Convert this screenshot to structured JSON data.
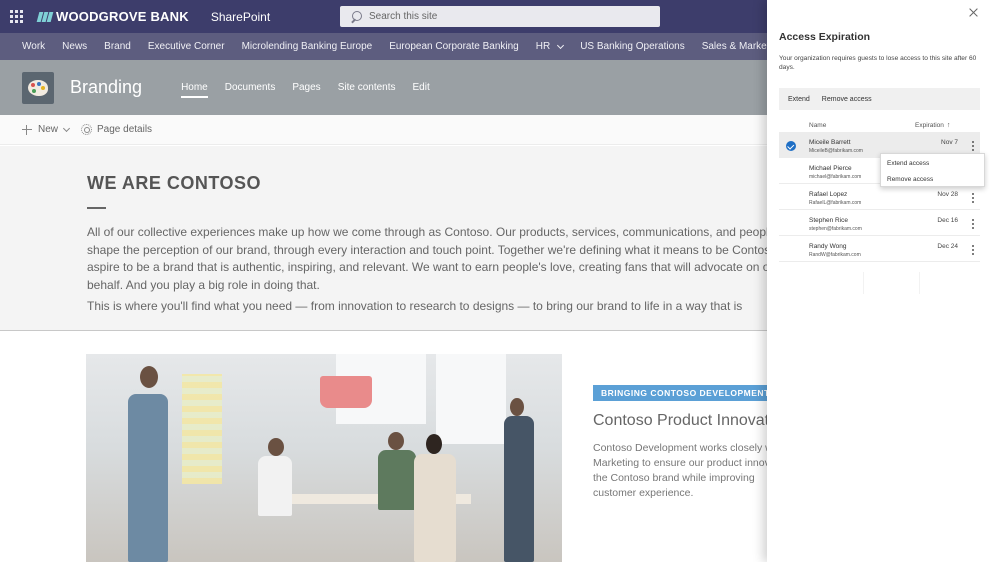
{
  "suite": {
    "brand": "WOODGROVE BANK",
    "app": "SharePoint",
    "search_placeholder": "Search this site"
  },
  "hubnav": [
    "Work",
    "News",
    "Brand",
    "Executive Corner",
    "Microlending Banking Europe",
    "European Corporate Banking",
    "HR",
    "US Banking Operations",
    "Sales & Marketing"
  ],
  "site": {
    "title": "Branding",
    "nav": [
      "Home",
      "Documents",
      "Pages",
      "Site contents",
      "Edit"
    ]
  },
  "commands": {
    "new": "New",
    "page_details": "Page details"
  },
  "hero": {
    "heading": "WE ARE CONTOSO",
    "para1": "All of our collective experiences make up how we come through as Contoso. Our products, services, communications, and people shape the perception of our brand, through every interaction and touch point. Together we're defining what it means to be Contoso. We aspire to be a brand that is authentic, inspiring, and relevant. We want to earn people's love, creating fans that will advocate on our behalf. And you play a big role in doing that.",
    "para2": "This is where you'll find what you need — from innovation to research to designs —  to bring our brand to life in a way that is"
  },
  "feature": {
    "tag": "BRINGING CONTOSO DEVELOPMENT TO",
    "title": "Contoso Product Innovation",
    "body_lines": [
      "Contoso Development works closely with",
      "Marketing to ensure our product innovation",
      "the Contoso brand while improving",
      "customer experience."
    ]
  },
  "panel": {
    "title": "Access Expiration",
    "description": "Your organization requires guests to lose access to this site after 60 days.",
    "commands": [
      "Extend",
      "Remove access"
    ],
    "columns": {
      "name": "Name",
      "expiration": "Expiration"
    },
    "sort_indicator": "↑",
    "rows": [
      {
        "name": "Miceile Barrett",
        "email": "MiceileB@fabrikam.com",
        "expiration": "Nov 7",
        "selected": true
      },
      {
        "name": "Michael Pierce",
        "email": "michael@fabrikam.com",
        "expiration": "",
        "selected": false
      },
      {
        "name": "Rafael Lopez",
        "email": "RafaelL@fabrikam.com",
        "expiration": "Nov 28",
        "selected": false
      },
      {
        "name": "Stephen Rice",
        "email": "stephen@fabrikam.com",
        "expiration": "Dec 16",
        "selected": false
      },
      {
        "name": "Randy Wong",
        "email": "RandW@fabrikam.com",
        "expiration": "Dec 24",
        "selected": false
      }
    ],
    "context_menu": [
      "Extend access",
      "Remove access"
    ]
  },
  "colors": {
    "suitebar": "#3d3d6b",
    "accent": "#1f6fc5",
    "tag": "#5ba0d6"
  }
}
